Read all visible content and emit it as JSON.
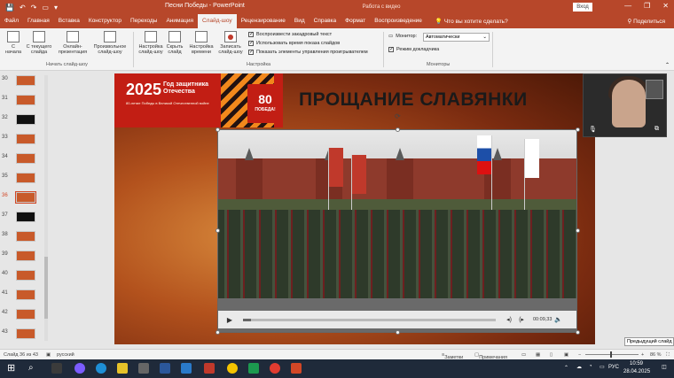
{
  "titlebar": {
    "qa_icons": [
      "save-icon",
      "undo-icon",
      "redo-icon",
      "start-slideshow-icon",
      "customize-icon"
    ],
    "title": "Песни Победы - PowerPoint",
    "context_label": "Работа с видео",
    "signin": "Вход",
    "winbtns": [
      "—",
      "❐",
      "✕"
    ]
  },
  "tabs": {
    "items": [
      "Файл",
      "Главная",
      "Вставка",
      "Конструктор",
      "Переходы",
      "Анимация",
      "Слайд-шоу",
      "Рецензирование",
      "Вид",
      "Справка",
      "Формат",
      "Воспроизведение"
    ],
    "active": "Слайд-шоу",
    "tellme": "Что вы хотите сделать?",
    "share": "Поделиться"
  },
  "ribbon": {
    "start_group": {
      "buttons": [
        "С начала",
        "С текущего слайда",
        "Онлайн-презентация",
        "Произвольное слайд-шоу"
      ],
      "label": "Начать слайд-шоу"
    },
    "setup_group": {
      "buttons": [
        "Настройка слайд-шоу",
        "Скрыть слайд",
        "Настройка времени",
        "Записать слайд-шоу"
      ],
      "checks": [
        {
          "label": "Воспроизвести закадровый текст",
          "checked": true
        },
        {
          "label": "Использовать время показа слайдов",
          "checked": true
        },
        {
          "label": "Показать элементы управления проигрывателем",
          "checked": true
        }
      ],
      "label": "Настройка"
    },
    "monitors_group": {
      "monitor_label": "Монитор:",
      "monitor_value": "Автоматически",
      "presenter_label": "Режим докладчика",
      "presenter_checked": true,
      "label": "Мониторы"
    }
  },
  "slide_panel": {
    "numbers": [
      "30",
      "31",
      "32",
      "33",
      "34",
      "35",
      "36",
      "37",
      "38",
      "39",
      "40",
      "41",
      "42",
      "43"
    ],
    "active": "36"
  },
  "slide": {
    "year": "2025",
    "year_sub": "Год защитника Отечества",
    "tagline": "80-летие Победы в Великой Отечественной войне",
    "emblem_num": "80",
    "emblem_word": "ПОБЕДА!",
    "headline": "ПРОЩАНИЕ СЛАВЯНКИ"
  },
  "video": {
    "time": "00:09,33",
    "progress": 0.03,
    "flag_colors": [
      "#c0392b",
      "#c0392b",
      "#ffffff",
      "#c0392b",
      "#c0392b"
    ]
  },
  "tooltip": "Предыдущий слайд",
  "statusbar": {
    "slide_info": "Слайд 36 из 43",
    "language": "русский",
    "notes": "Заметки",
    "comments": "Примечания",
    "zoom": "86 %"
  },
  "taskbar": {
    "lang": "РУС",
    "time": "10:59",
    "date": "28.04.2025"
  },
  "colors": {
    "accent": "#b7472a",
    "taskbar": "#1f2a3a"
  }
}
